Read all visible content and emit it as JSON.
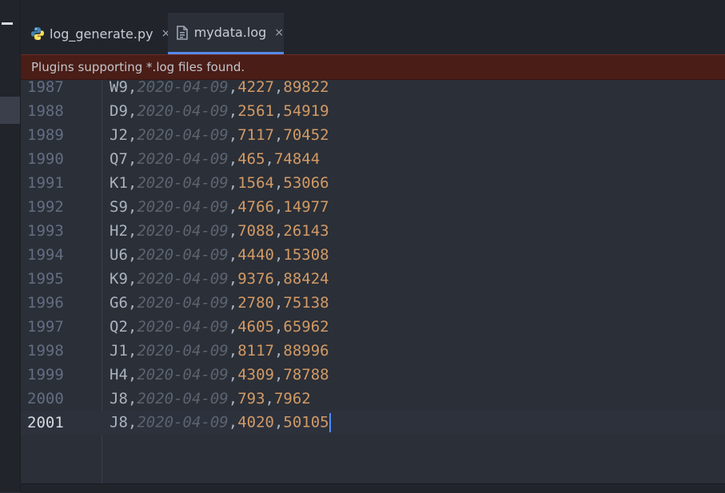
{
  "tabs": [
    {
      "label": "log_generate.py",
      "icon": "python-icon",
      "active": false
    },
    {
      "label": "mydata.log",
      "icon": "file-icon",
      "active": true
    }
  ],
  "tab_close_glyph": "×",
  "notification": "Plugins supporting *.log files found.",
  "lines": [
    {
      "num": "1987",
      "id": "W9",
      "date": "2020-04-09",
      "a": "4227",
      "b": "89822"
    },
    {
      "num": "1988",
      "id": "D9",
      "date": "2020-04-09",
      "a": "2561",
      "b": "54919"
    },
    {
      "num": "1989",
      "id": "J2",
      "date": "2020-04-09",
      "a": "7117",
      "b": "70452"
    },
    {
      "num": "1990",
      "id": "Q7",
      "date": "2020-04-09",
      "a": "465",
      "b": "74844"
    },
    {
      "num": "1991",
      "id": "K1",
      "date": "2020-04-09",
      "a": "1564",
      "b": "53066"
    },
    {
      "num": "1992",
      "id": "S9",
      "date": "2020-04-09",
      "a": "4766",
      "b": "14977"
    },
    {
      "num": "1993",
      "id": "H2",
      "date": "2020-04-09",
      "a": "7088",
      "b": "26143"
    },
    {
      "num": "1994",
      "id": "U6",
      "date": "2020-04-09",
      "a": "4440",
      "b": "15308"
    },
    {
      "num": "1995",
      "id": "K9",
      "date": "2020-04-09",
      "a": "9376",
      "b": "88424"
    },
    {
      "num": "1996",
      "id": "G6",
      "date": "2020-04-09",
      "a": "2780",
      "b": "75138"
    },
    {
      "num": "1997",
      "id": "Q2",
      "date": "2020-04-09",
      "a": "4605",
      "b": "65962"
    },
    {
      "num": "1998",
      "id": "J1",
      "date": "2020-04-09",
      "a": "8117",
      "b": "88996"
    },
    {
      "num": "1999",
      "id": "H4",
      "date": "2020-04-09",
      "a": "4309",
      "b": "78788"
    },
    {
      "num": "2000",
      "id": "J8",
      "date": "2020-04-09",
      "a": "793",
      "b": "7962"
    },
    {
      "num": "2001",
      "id": "J8",
      "date": "2020-04-09",
      "a": "4020",
      "b": "50105",
      "current": true
    }
  ],
  "colors": {
    "accent": "#568af2",
    "notification_bg": "#4a1d17",
    "number": "#d19a66",
    "date": "#5c6370"
  }
}
